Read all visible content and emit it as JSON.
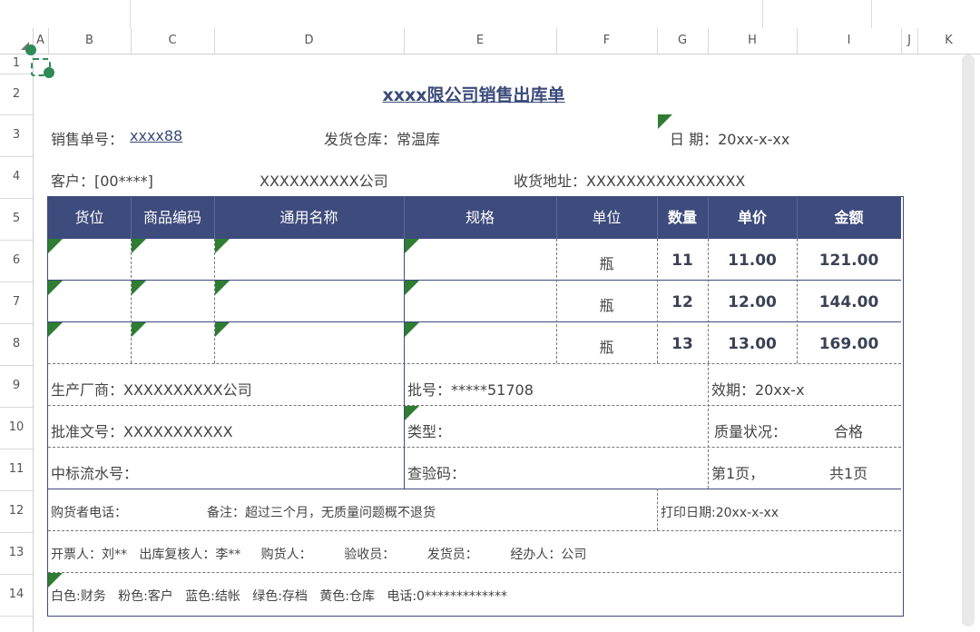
{
  "columns": [
    "A",
    "B",
    "C",
    "D",
    "E",
    "F",
    "G",
    "H",
    "I",
    "J",
    "K"
  ],
  "rows": [
    "1",
    "2",
    "3",
    "4",
    "5",
    "6",
    "7",
    "8",
    "9",
    "10",
    "11",
    "12",
    "13",
    "14"
  ],
  "sheet": {
    "title": "xxxx限公司销售出库单",
    "order_label": "销售单号：",
    "order_value": "xxxx88",
    "warehouse": "发货仓库：常温库",
    "date": "日  期：20xx-x-xx",
    "customer": "客户：[00****]",
    "company": "XXXXXXXXXX公司",
    "address": "收货地址：XXXXXXXXXXXXXXXX"
  },
  "table": {
    "headers": [
      "货位",
      "商品编码",
      "通用名称",
      "规格",
      "单位",
      "数量",
      "单价",
      "金额"
    ],
    "rows": [
      {
        "unit": "瓶",
        "qty": "11",
        "price": "11.00",
        "amount": "121.00"
      },
      {
        "unit": "瓶",
        "qty": "12",
        "price": "12.00",
        "amount": "144.00"
      },
      {
        "unit": "瓶",
        "qty": "13",
        "price": "13.00",
        "amount": "169.00"
      }
    ]
  },
  "details": {
    "manufacturer": "生产厂商：XXXXXXXXXX公司",
    "batch": "批号：*****51708",
    "expiry": "效期：20xx-x",
    "approval": "批准文号：XXXXXXXXXXX",
    "type": "类型：",
    "quality_label": "质量状况：",
    "quality_value": "合格",
    "bid_serial": "中标流水号：",
    "verify_code": "查验码：",
    "page_current": "第1页，",
    "page_total": "共1页",
    "buyer_phone": "购货者电话：",
    "remark": "备注：超过三个月，无质量问题概不退货",
    "print_date": "打印日期:20xx-x-xx",
    "signers": "开票人：刘**   出库复核人：李**     购货人：        验收员：        发货员：        经办人：公司",
    "colors": "白色:财务   粉色:客户   蓝色:结帐   绿色:存档   黄色:仓库   电话:0*************"
  },
  "accent_color": "#3d4b7d",
  "comment_marker_color": "#2e7d32"
}
